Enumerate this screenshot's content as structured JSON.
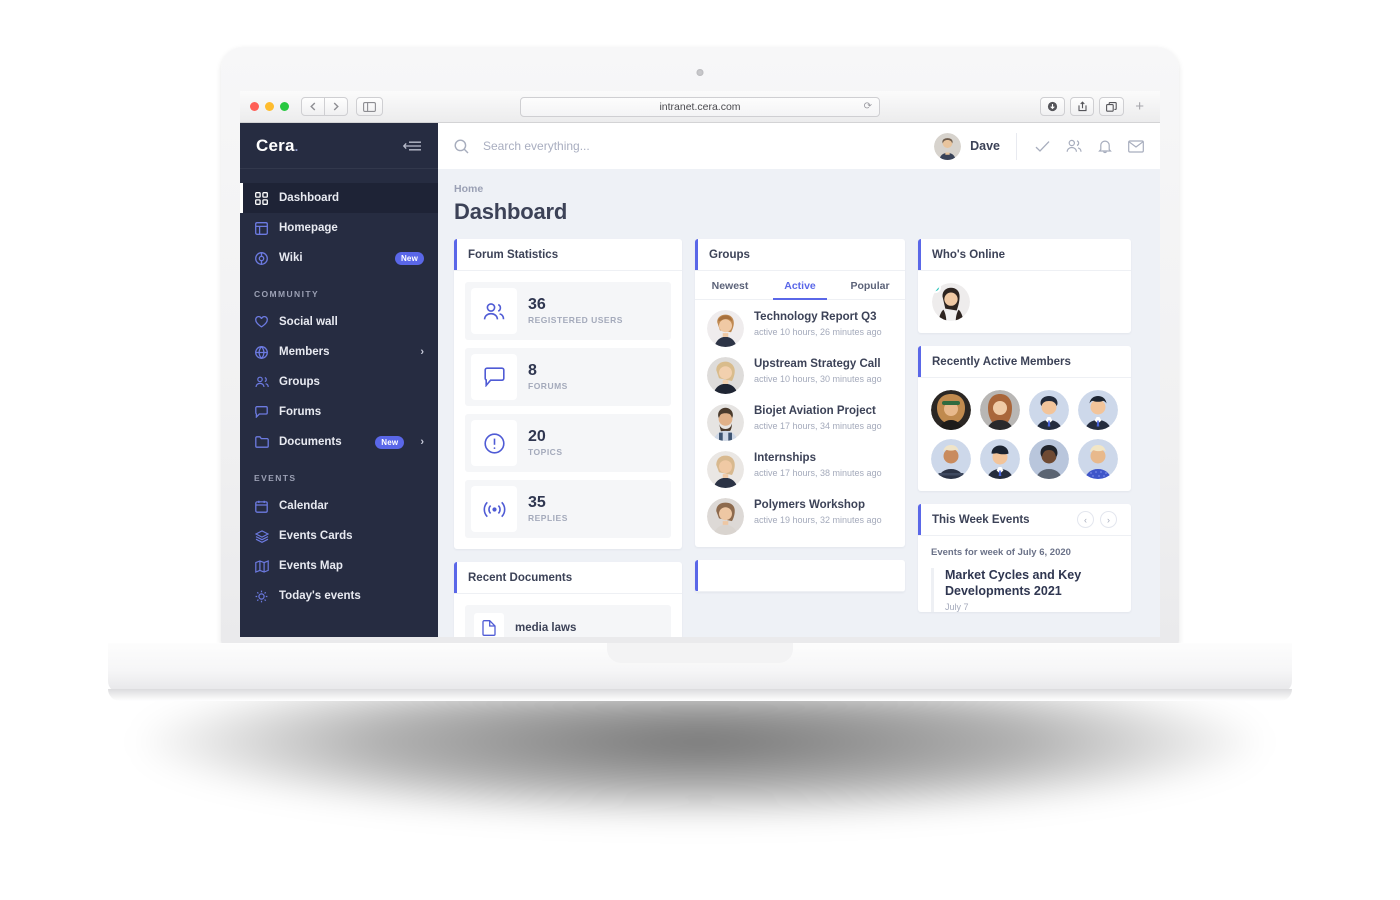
{
  "browser": {
    "url": "intranet.cera.com",
    "reload_icon": "reload-icon",
    "back_icon": "chevron-left-icon",
    "forward_icon": "chevron-right-icon",
    "sidebar_toggle_icon": "sidebar-toggle-icon",
    "download_icon": "download-icon",
    "share_icon": "share-icon",
    "tabs_icon": "tabs-overview-icon",
    "new_tab_label": "+"
  },
  "sidebar": {
    "brand": "Cera",
    "brand_dot": ".",
    "collapse_icon": "collapse-sidebar-icon",
    "items": [
      {
        "label": "Dashboard",
        "icon": "grid-icon",
        "active": true
      },
      {
        "label": "Homepage",
        "icon": "layout-icon",
        "active": false
      },
      {
        "label": "Wiki",
        "icon": "wiki-circle-icon",
        "active": false,
        "badge": "New"
      }
    ],
    "sections": [
      {
        "title": "COMMUNITY",
        "items": [
          {
            "label": "Social wall",
            "icon": "heart-icon"
          },
          {
            "label": "Members",
            "icon": "globe-icon",
            "chevron": true
          },
          {
            "label": "Groups",
            "icon": "users-icon"
          },
          {
            "label": "Forums",
            "icon": "chat-icon"
          },
          {
            "label": "Documents",
            "icon": "folder-icon",
            "badge": "New",
            "chevron": true
          }
        ]
      },
      {
        "title": "EVENTS",
        "items": [
          {
            "label": "Calendar",
            "icon": "calendar-icon"
          },
          {
            "label": "Events Cards",
            "icon": "layers-icon"
          },
          {
            "label": "Events Map",
            "icon": "map-icon"
          },
          {
            "label": "Today's events",
            "icon": "sun-icon"
          }
        ]
      }
    ]
  },
  "topbar": {
    "search_icon": "search-icon",
    "search_placeholder": "Search everything...",
    "user_name": "Dave",
    "avatar": "user-avatar",
    "icons": [
      "check-icon",
      "people-icon",
      "bell-icon",
      "mail-icon"
    ]
  },
  "page": {
    "breadcrumb": "Home",
    "title": "Dashboard"
  },
  "forum_statistics": {
    "title": "Forum Statistics",
    "stats": [
      {
        "value": "36",
        "label": "REGISTERED USERS",
        "icon": "users-stat-icon"
      },
      {
        "value": "8",
        "label": "FORUMS",
        "icon": "chat-stat-icon"
      },
      {
        "value": "20",
        "label": "TOPICS",
        "icon": "alert-stat-icon"
      },
      {
        "value": "35",
        "label": "REPLIES",
        "icon": "broadcast-stat-icon"
      }
    ]
  },
  "recent_documents": {
    "title": "Recent Documents",
    "items": [
      {
        "name": "media laws",
        "icon": "document-icon"
      }
    ]
  },
  "groups": {
    "title": "Groups",
    "tabs": [
      {
        "label": "Newest",
        "active": false
      },
      {
        "label": "Active",
        "active": true
      },
      {
        "label": "Popular",
        "active": false
      }
    ],
    "items": [
      {
        "name": "Technology Report Q3",
        "meta": "active 10 hours, 26 minutes ago"
      },
      {
        "name": "Upstream Strategy Call",
        "meta": "active 10 hours, 30 minutes ago"
      },
      {
        "name": "Biojet Aviation Project",
        "meta": "active 17 hours, 34 minutes ago"
      },
      {
        "name": "Internships",
        "meta": "active 17 hours, 38 minutes ago"
      },
      {
        "name": "Polymers Workshop",
        "meta": "active 19 hours, 32 minutes ago"
      }
    ]
  },
  "whos_online": {
    "title": "Who's Online",
    "members": [
      {
        "status": "online"
      }
    ]
  },
  "recently_active": {
    "title": "Recently Active Members",
    "count": 8
  },
  "this_week_events": {
    "title": "This Week Events",
    "prev_icon": "chevron-left-icon",
    "next_icon": "chevron-right-icon",
    "week_label": "Events for week of July 6, 2020",
    "events": [
      {
        "title": "Market Cycles and Key Developments 2021",
        "sub": "July 7"
      }
    ]
  },
  "colors": {
    "accent": "#5a67e8",
    "sidebar_bg": "#262c41",
    "page_bg": "#eef1f6",
    "online": "#23c4b8",
    "text_dark": "#3c4257",
    "text_muted": "#a4aabb"
  }
}
